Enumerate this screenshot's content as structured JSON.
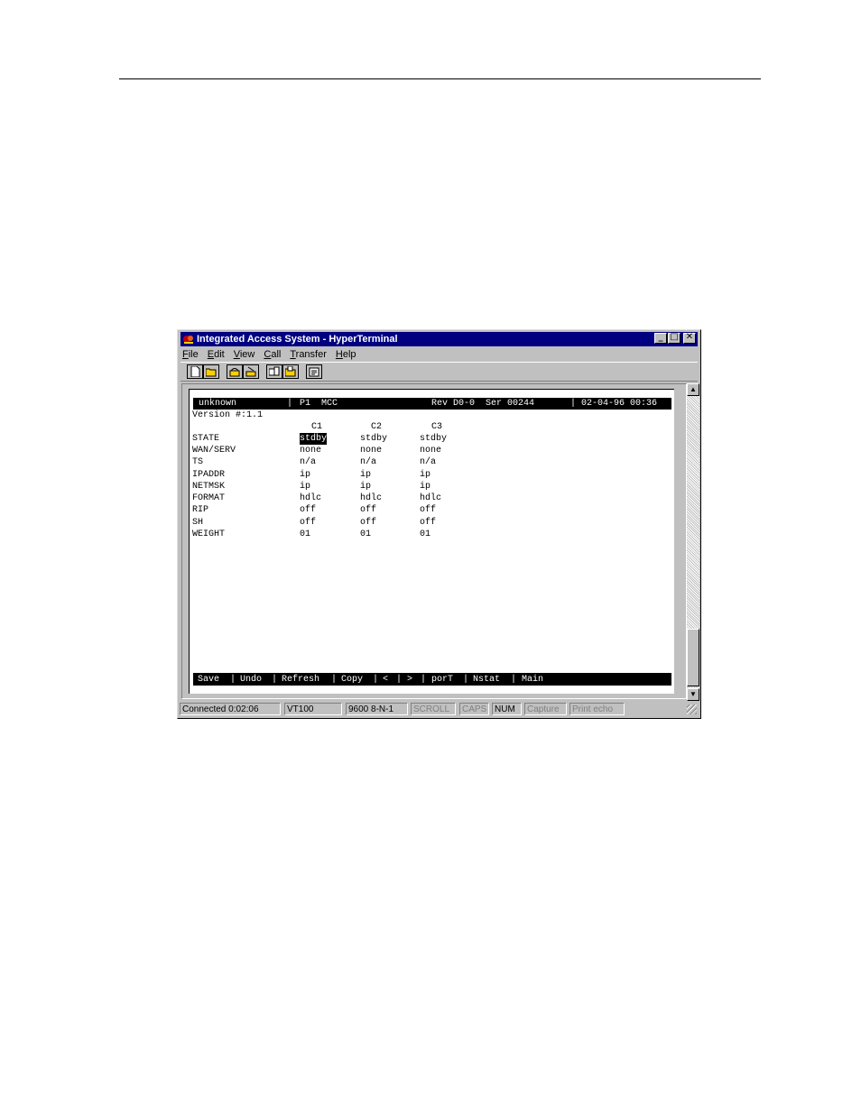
{
  "window": {
    "title": "Integrated Access System - HyperTerminal",
    "controls": {
      "minimize": "_",
      "maximize": "□",
      "close": "✕"
    }
  },
  "menubar": [
    {
      "accel": "F",
      "rest": "ile"
    },
    {
      "accel": "E",
      "rest": "dit"
    },
    {
      "accel": "V",
      "rest": "iew"
    },
    {
      "accel": "C",
      "rest": "all"
    },
    {
      "accel": "T",
      "rest": "ransfer"
    },
    {
      "accel": "H",
      "rest": "elp"
    }
  ],
  "toolbar": {
    "icons": [
      "new-icon",
      "open-icon",
      "connect-icon",
      "disconnect-icon",
      "send-icon",
      "receive-icon",
      "properties-icon"
    ]
  },
  "terminal": {
    "header": {
      "node": "unknown",
      "sep1": "|",
      "slot": "P1  MCC",
      "rev": "Rev D0-0  Ser 00244",
      "sep2": "|",
      "datetime": "02-04-96 00:36"
    },
    "version": "Version #:1.1",
    "columns": [
      "C1",
      "C2",
      "C3"
    ],
    "rows": [
      {
        "label": "STATE",
        "values": [
          "stdby",
          "stdby",
          "stdby"
        ]
      },
      {
        "label": "WAN/SERV",
        "values": [
          "none",
          "none",
          "none"
        ]
      },
      {
        "label": "TS",
        "values": [
          "n/a",
          "n/a",
          "n/a"
        ]
      },
      {
        "label": "IPADDR",
        "values": [
          "ip",
          "ip",
          "ip"
        ]
      },
      {
        "label": "NETMSK",
        "values": [
          "ip",
          "ip",
          "ip"
        ]
      },
      {
        "label": "FORMAT",
        "values": [
          "hdlc",
          "hdlc",
          "hdlc"
        ]
      },
      {
        "label": "RIP",
        "values": [
          "off",
          "off",
          "off"
        ]
      },
      {
        "label": "SH",
        "values": [
          "off",
          "off",
          "off"
        ]
      },
      {
        "label": "WEIGHT",
        "values": [
          "01",
          "01",
          "01"
        ]
      }
    ],
    "commands": [
      "Save",
      "Undo",
      "Refresh",
      "Copy",
      "<",
      ">",
      "porT",
      "Nstat",
      "Main"
    ]
  },
  "statusbar": {
    "connected": "Connected 0:02:06",
    "emulation": "VT100",
    "settings": "9600 8-N-1",
    "scroll": "SCROLL",
    "caps": "CAPS",
    "num": "NUM",
    "capture": "Capture",
    "print_echo": "Print echo"
  }
}
